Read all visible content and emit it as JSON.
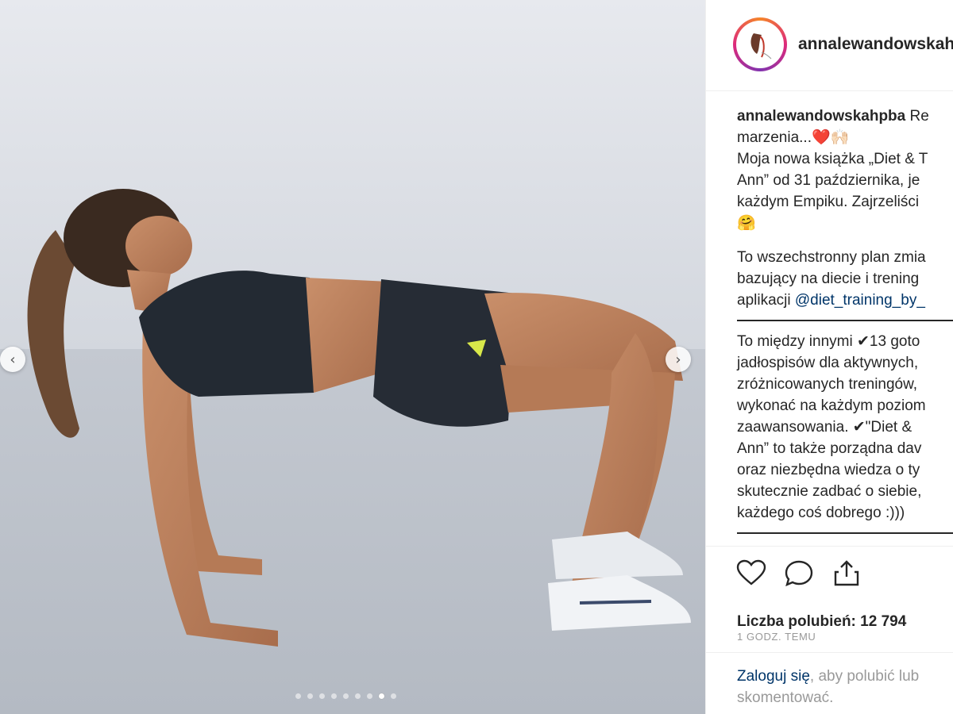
{
  "post": {
    "username": "annalewandowskahpba",
    "avatar_icon": "profile-avatar-icon",
    "caption": {
      "author": "annalewandowskahpba",
      "lines": [
        " Re",
        "marzenia...❤️🙌🏻",
        "Moja nowa książka „Diet & T",
        "Ann” od 31 października, je",
        "każdym Empiku. Zajrzeliści",
        "🤗"
      ],
      "lines2": [
        "To wszechstronny plan zmia",
        "bazujący na diecie i trening"
      ],
      "mention_prefix": "aplikacji ",
      "mention": "@diet_training_by_",
      "lines3": [
        "To między innymi ✔13 goto",
        "jadłospisów dla aktywnych,",
        "zróżnicowanych treningów,",
        "wykonać na każdym poziom",
        "zaawansowania. ✔\"Diet &",
        "Ann” to także porządna dav",
        "oraz niezbędna wiedza o ty",
        "skutecznie zadbać o siebie,",
        "każdego coś dobrego :)))"
      ]
    },
    "likes": "Liczba polubień: 12 794",
    "time": "1 GODZ. TEMU",
    "login": {
      "link": "Zaloguj się",
      "rest": ", aby polubić lub",
      "line2": "skomentować."
    }
  },
  "carousel": {
    "prev_label": "‹",
    "next_label": "›",
    "slide_count": 9,
    "active_slide": 8
  },
  "icons": [
    "heart-icon",
    "comment-icon",
    "share-icon"
  ],
  "colors": {
    "link": "#003569",
    "muted": "#999999",
    "text": "#262626"
  }
}
